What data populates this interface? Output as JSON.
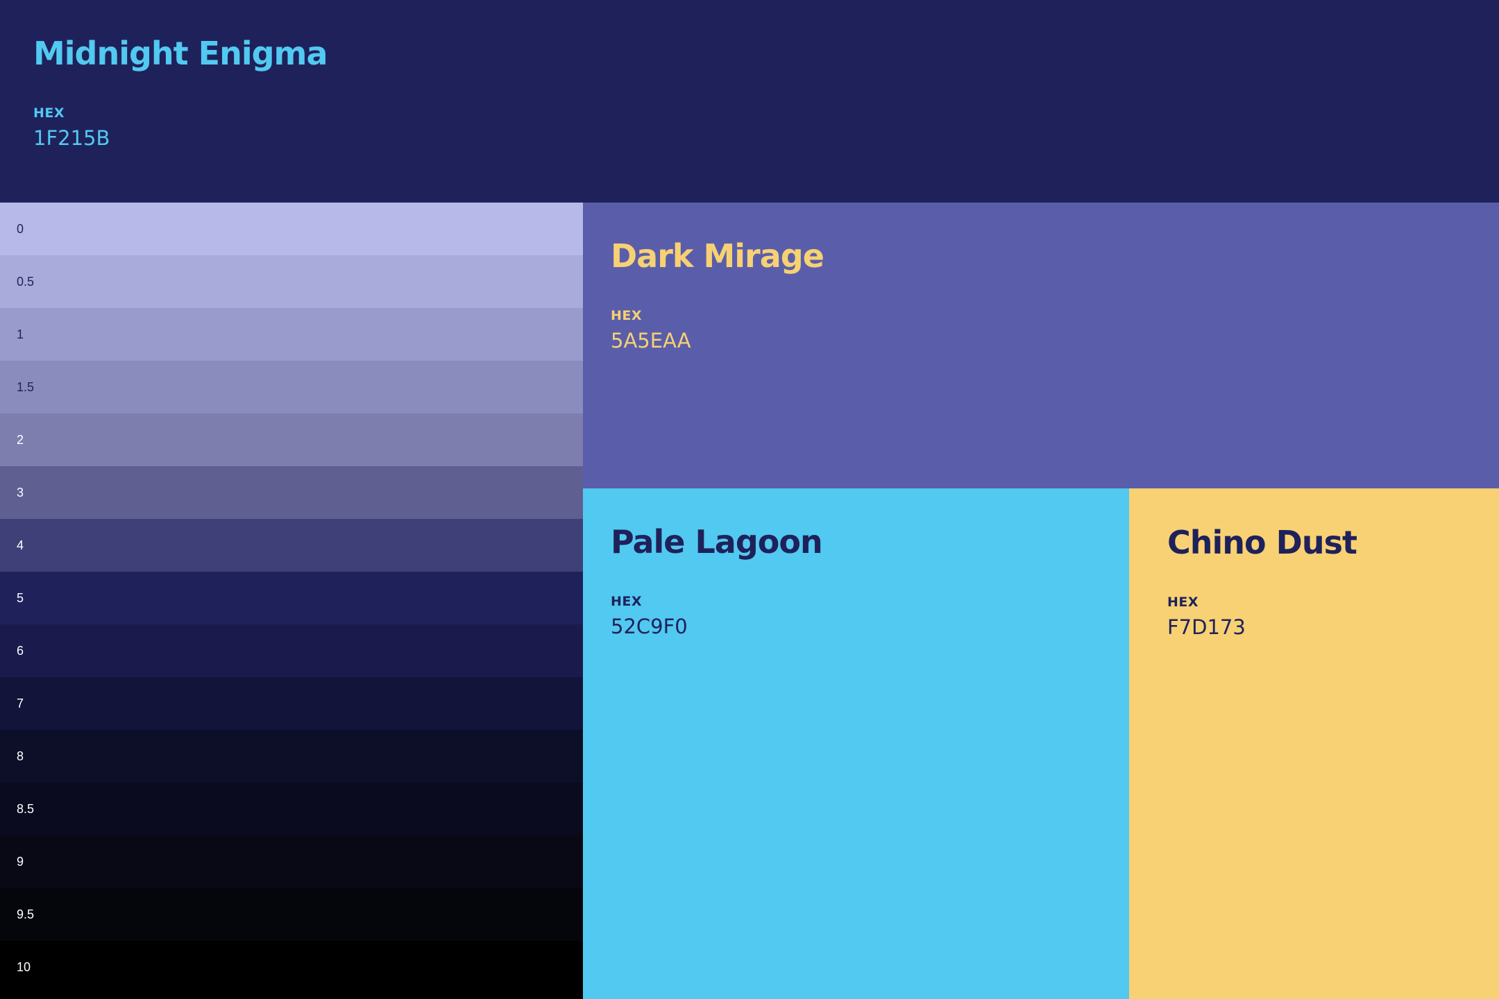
{
  "main_color": {
    "name": "Midnight Enigma",
    "hex_label": "HEX",
    "hex": "1F215B",
    "background": "#1F215B",
    "text_color": "#52C9F0"
  },
  "shade_scale": [
    {
      "label": "0",
      "color": "#B7BAE8",
      "text_color": "#1F215B"
    },
    {
      "label": "0.5",
      "color": "#A9ABDA",
      "text_color": "#1F215B"
    },
    {
      "label": "1",
      "color": "#999BCC",
      "text_color": "#1F215B"
    },
    {
      "label": "1.5",
      "color": "#8B8CBE",
      "text_color": "#1F215B"
    },
    {
      "label": "2",
      "color": "#7D7EAE",
      "text_color": "#FFFFFF"
    },
    {
      "label": "3",
      "color": "#5F5F91",
      "text_color": "#FFFFFF"
    },
    {
      "label": "4",
      "color": "#404078",
      "text_color": "#FFFFFF"
    },
    {
      "label": "5",
      "color": "#1F215B",
      "text_color": "#FFFFFF"
    },
    {
      "label": "6",
      "color": "#1A1B4C",
      "text_color": "#FFFFFF"
    },
    {
      "label": "7",
      "color": "#13143A",
      "text_color": "#FFFFFF"
    },
    {
      "label": "8",
      "color": "#0D0E27",
      "text_color": "#FFFFFF"
    },
    {
      "label": "8.5",
      "color": "#0A0B1E",
      "text_color": "#FFFFFF"
    },
    {
      "label": "9",
      "color": "#080915",
      "text_color": "#FFFFFF"
    },
    {
      "label": "9.5",
      "color": "#05060C",
      "text_color": "#FFFFFF"
    },
    {
      "label": "10",
      "color": "#000000",
      "text_color": "#FFFFFF"
    }
  ],
  "swatches": [
    {
      "name": "Dark Mirage",
      "hex_label": "HEX",
      "hex": "5A5EAA",
      "background": "#5A5EAA",
      "text_color": "#F7D173"
    },
    {
      "name": "Pale Lagoon",
      "hex_label": "HEX",
      "hex": "52C9F0",
      "background": "#52C9F0",
      "text_color": "#1F215B"
    },
    {
      "name": "Chino Dust",
      "hex_label": "HEX",
      "hex": "F7D173",
      "background": "#F7D173",
      "text_color": "#1F215B"
    }
  ]
}
